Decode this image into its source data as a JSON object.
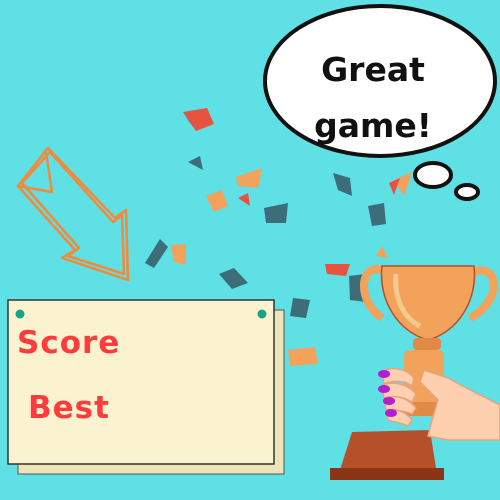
{
  "speech_bubble": {
    "line1": "Great",
    "line2": "game!"
  },
  "board": {
    "score_label": "Score",
    "best_label": "Best"
  },
  "colors": {
    "background": "#5ee0e4",
    "board_fill": "#fbf3d0",
    "board_shadow": "#efe4b8",
    "pin": "#1aa18a",
    "label_text": "#ff3b3b",
    "arrow": "#f08a3c",
    "trophy_gold": "#f2a25a",
    "trophy_base": "#b5502a",
    "hand": "#ffd0b0",
    "nail_polish": "#b51dcf",
    "confetti_teal": "#3d6d78",
    "confetti_orange": "#f2a25a",
    "confetti_red": "#e8523e"
  },
  "icons": [
    "hand-drawn-arrow-icon",
    "trophy-icon",
    "hand-icon",
    "speech-bubble-icon",
    "confetti-icon"
  ]
}
